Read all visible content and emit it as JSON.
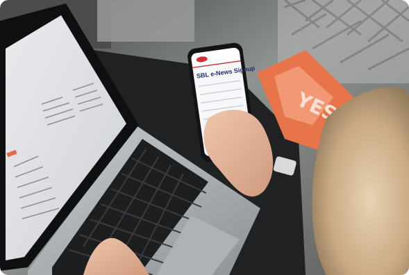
{
  "photo": {
    "phone_screen": {
      "heading": "SBL e-News Signup"
    }
  }
}
